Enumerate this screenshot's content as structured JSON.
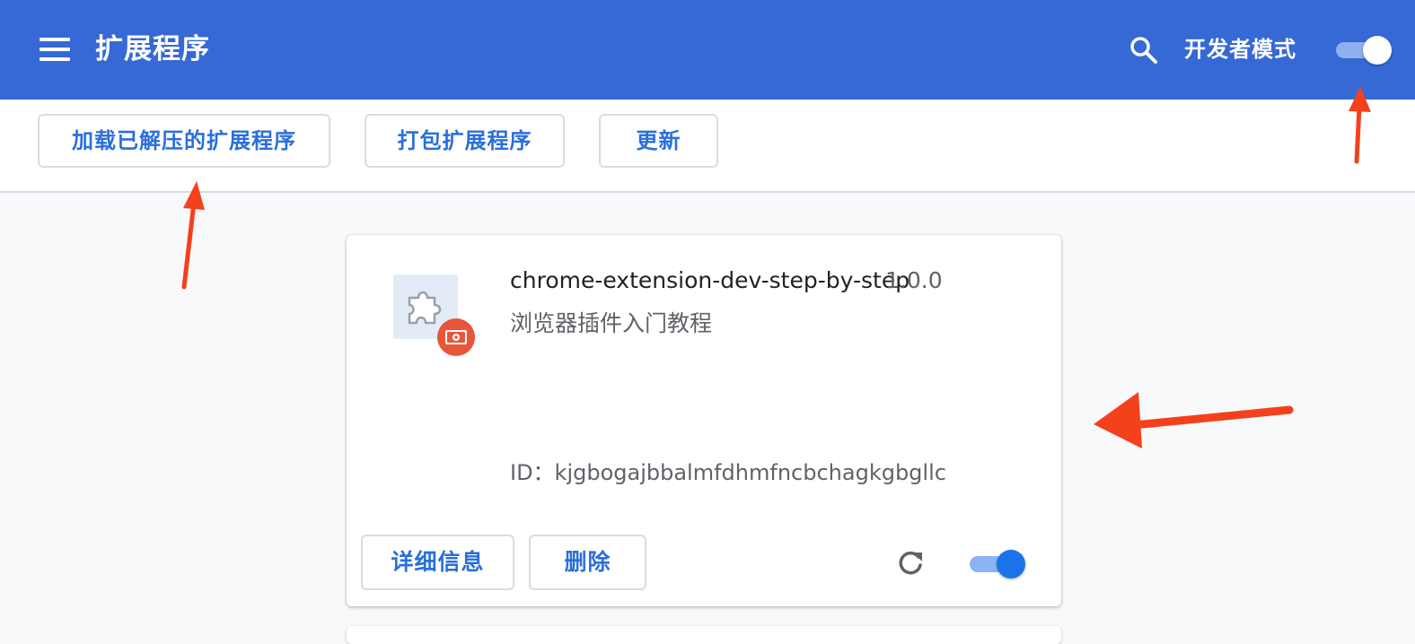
{
  "header": {
    "title": "扩展程序",
    "menu_icon": "menu-icon",
    "search_icon": "search-icon",
    "dev_mode_label": "开发者模式",
    "dev_mode_enabled": true,
    "background_color": "#3669d6"
  },
  "toolbar": {
    "load_unpacked_label": "加载已解压的扩展程序",
    "pack_label": "打包扩展程序",
    "update_label": "更新"
  },
  "extension": {
    "name": "chrome-extension-dev-step-by-step",
    "version": "1.0.0",
    "description": "浏览器插件入门教程",
    "id_text": "ID：kjgbogajbbalmfdhmfncbchagkgbgllc",
    "icon": "puzzle-icon",
    "badge_icon": "unpacked-badge-icon",
    "details_label": "详细信息",
    "remove_label": "删除",
    "reload_icon": "reload-icon",
    "enabled": true
  },
  "colors": {
    "accent": "#2a6fdb",
    "annotation_arrow": "#f5401c"
  }
}
